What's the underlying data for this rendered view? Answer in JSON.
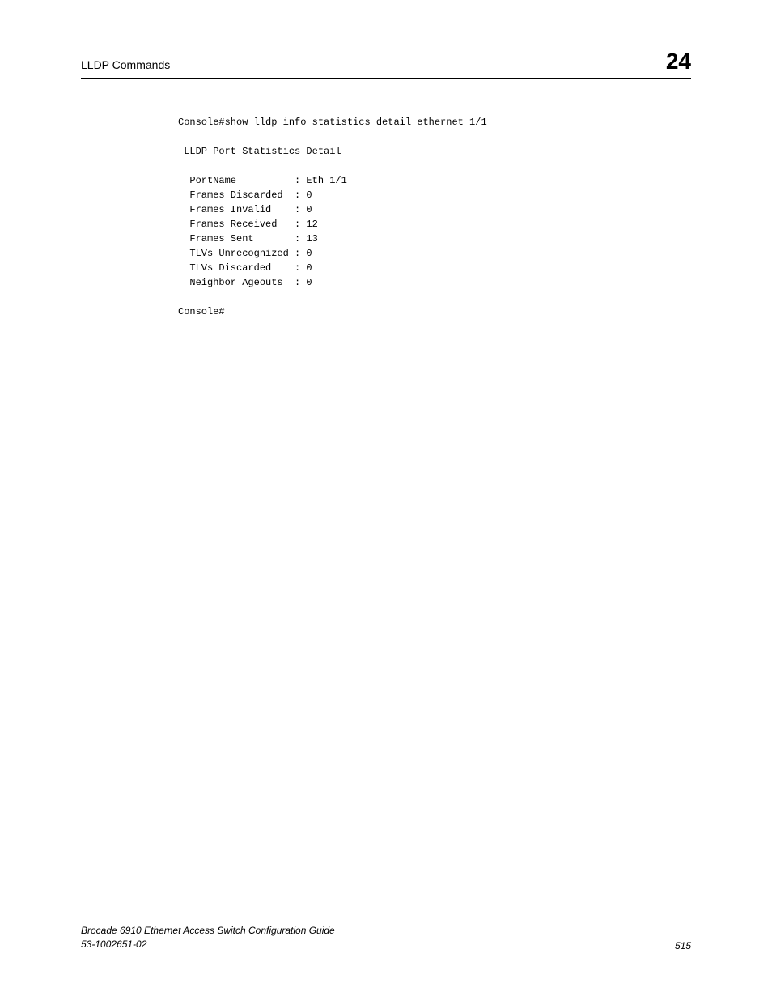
{
  "header": {
    "section_title": "LLDP Commands",
    "chapter_number": "24"
  },
  "console": {
    "command_line": "Console#show lldp info statistics detail ethernet 1/1",
    "heading": " LLDP Port Statistics Detail",
    "stats": [
      {
        "label": "PortName",
        "value": "Eth 1/1"
      },
      {
        "label": "Frames Discarded",
        "value": "0"
      },
      {
        "label": "Frames Invalid",
        "value": "0"
      },
      {
        "label": "Frames Received",
        "value": "12"
      },
      {
        "label": "Frames Sent",
        "value": "13"
      },
      {
        "label": "TLVs Unrecognized",
        "value": "0"
      },
      {
        "label": "TLVs Discarded",
        "value": "0"
      },
      {
        "label": "Neighbor Ageouts",
        "value": "0"
      }
    ],
    "prompt": "Console#"
  },
  "footer": {
    "book_title": "Brocade 6910 Ethernet Access Switch Configuration Guide",
    "doc_number": "53-1002651-02",
    "page_number": "515"
  }
}
